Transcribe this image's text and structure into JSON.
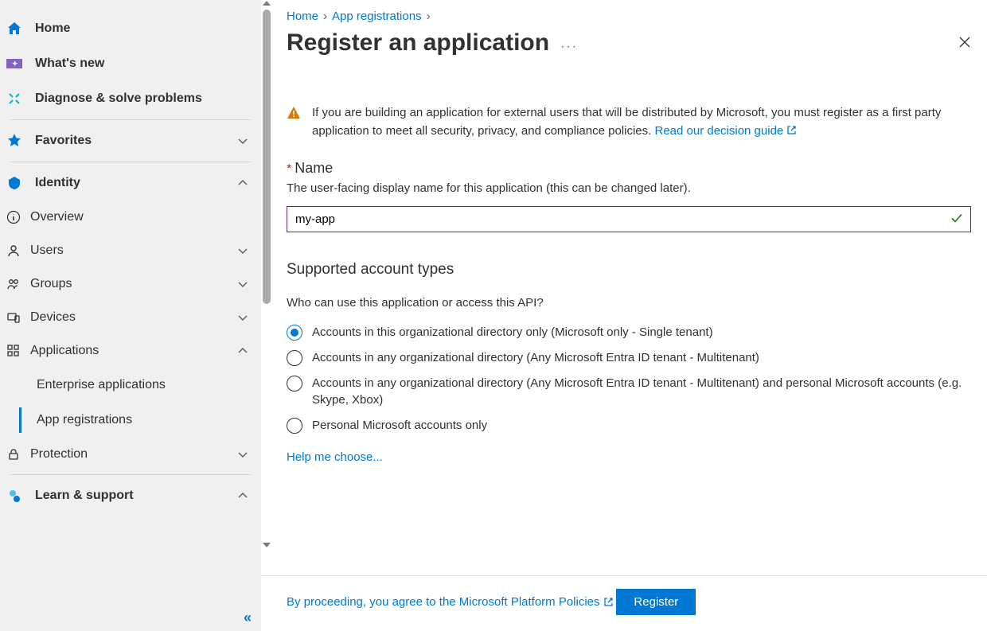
{
  "colors": {
    "link": "#0078d4",
    "warn": "#d97706",
    "success": "#107c10"
  },
  "sidebar": {
    "top": {
      "home": "Home",
      "whatsnew": "What's new",
      "diagnose": "Diagnose & solve problems"
    },
    "favorites": "Favorites",
    "identity": {
      "label": "Identity",
      "overview": "Overview",
      "users": "Users",
      "groups": "Groups",
      "devices": "Devices",
      "applications": {
        "label": "Applications",
        "enterprise": "Enterprise applications",
        "appreg": "App registrations"
      },
      "protection": "Protection"
    },
    "learn": "Learn & support"
  },
  "breadcrumb": {
    "home": "Home",
    "appreg": "App registrations"
  },
  "header": {
    "title": "Register an application"
  },
  "notice": {
    "text": "If you are building an application for external users that will be distributed by Microsoft, you must register as a first party application to meet all security, privacy, and compliance policies. ",
    "link": "Read our decision guide"
  },
  "form": {
    "name": {
      "label": "Name",
      "help": "The user-facing display name for this application (this can be changed later).",
      "value": "my-app"
    },
    "accounts": {
      "title": "Supported account types",
      "sub": "Who can use this application or access this API?",
      "options": [
        "Accounts in this organizational directory only (Microsoft only - Single tenant)",
        "Accounts in any organizational directory (Any Microsoft Entra ID tenant - Multitenant)",
        "Accounts in any organizational directory (Any Microsoft Entra ID tenant - Multitenant) and personal Microsoft accounts (e.g. Skype, Xbox)",
        "Personal Microsoft accounts only"
      ],
      "help_link": "Help me choose..."
    }
  },
  "footer": {
    "policies": "By proceeding, you agree to the Microsoft Platform Policies",
    "register": "Register"
  }
}
